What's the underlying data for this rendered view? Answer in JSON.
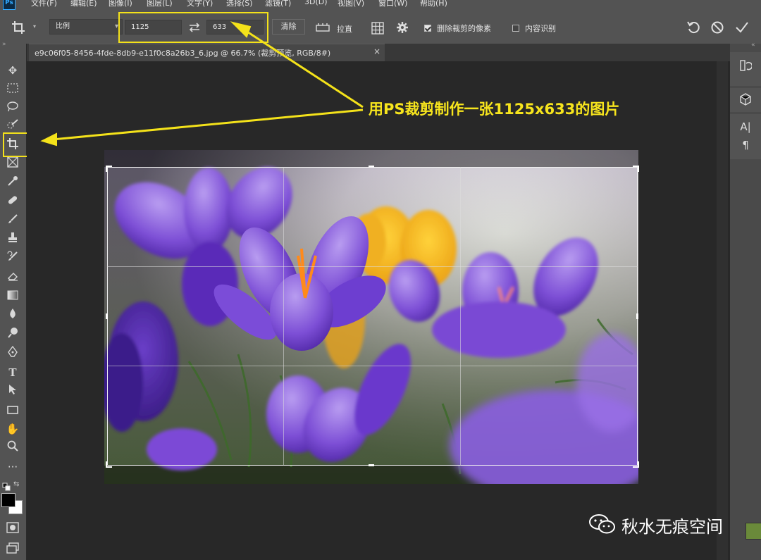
{
  "menubar": {
    "logo": "Ps",
    "items": [
      "文件(F)",
      "编辑(E)",
      "图像(I)",
      "图层(L)",
      "文字(Y)",
      "选择(S)",
      "滤镜(T)",
      "3D(D)",
      "视图(V)",
      "窗口(W)",
      "帮助(H)"
    ]
  },
  "options": {
    "tool_icon": "crop-icon",
    "ratio_select": "比例",
    "width_value": "1125",
    "height_value": "633",
    "swap_icon": "swap-arrows-icon",
    "clear_label": "清除",
    "straighten_label": "拉直",
    "grid_icon": "overlay-grid-icon",
    "settings_icon": "gear-icon",
    "delete_cropped_label": "删除裁剪的像素",
    "delete_cropped_checked": true,
    "content_aware_label": "内容识别",
    "content_aware_checked": false,
    "reset_icon": "reset-icon",
    "cancel_icon": "cancel-icon",
    "commit_icon": "checkmark-icon"
  },
  "document": {
    "tab_title": "e9c06f05-8456-4fde-8db9-e11f0c8a26b3_6.jpg  @  66.7% (裁剪预览, RGB/8#)",
    "close": "×"
  },
  "annotation": {
    "text": "用PS裁剪制作一张1125x633的图片",
    "color": "#f7e51d"
  },
  "watermark": {
    "text": "秋水无痕空间"
  },
  "colors": {
    "accent_highlight": "#f4e21a",
    "ui_panel": "#535353",
    "canvas_bg": "#282828"
  }
}
